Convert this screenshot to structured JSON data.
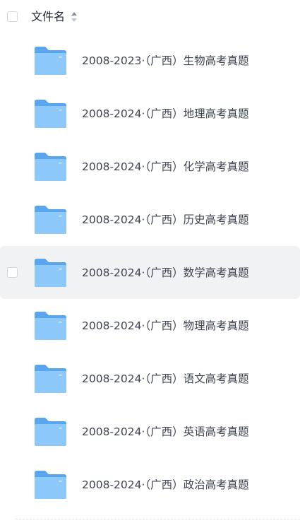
{
  "header": {
    "title": "文件名",
    "sort_icon": "sort-icon"
  },
  "colors": {
    "folder_back": "#5aa6ee",
    "folder_front": "#8cc8fa",
    "hover_background": "#f1f2f4"
  },
  "files": [
    {
      "name": "2008-2023·（广西）生物高考真题",
      "icon": "folder-icon"
    },
    {
      "name": "2008-2024·（广西）地理高考真题",
      "icon": "folder-icon"
    },
    {
      "name": "2008-2024·（广西）化学高考真题",
      "icon": "folder-icon"
    },
    {
      "name": "2008-2024·（广西）历史高考真题",
      "icon": "folder-icon"
    },
    {
      "name": "2008-2024·（广西）数学高考真题",
      "icon": "folder-icon",
      "hovered": true
    },
    {
      "name": "2008-2024·（广西）物理高考真题",
      "icon": "folder-icon"
    },
    {
      "name": "2008-2024·（广西）语文高考真题",
      "icon": "folder-icon"
    },
    {
      "name": "2008-2024·（广西）英语高考真题",
      "icon": "folder-icon"
    },
    {
      "name": "2008-2024·（广西）政治高考真题",
      "icon": "folder-icon"
    }
  ]
}
